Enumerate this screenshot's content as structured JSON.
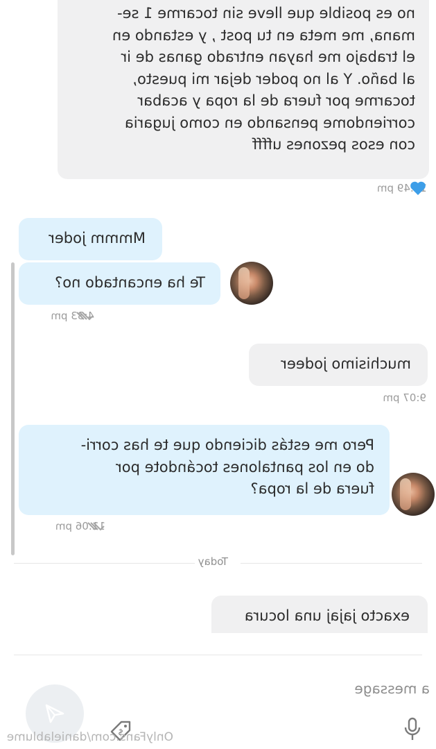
{
  "conversation": {
    "messages": [
      {
        "id": "m1",
        "direction": "outgoing",
        "lines": [
          "no es posible que lleve sin tocarme 1 se-",
          "mana, me meta en tu post , y estando en",
          "el trabajo me hayan entrado ganas de ir",
          "al baño. Y al no poder dejar mi puesto,",
          "tocarme por fuera de la ropa y acabar",
          "corriendome pensando en como jugaria",
          "con esos pezones uffff"
        ],
        "time": "12:49 pm",
        "liked": true
      },
      {
        "id": "m2",
        "direction": "incoming",
        "lines": [
          "Mmmm joder"
        ]
      },
      {
        "id": "m3",
        "direction": "incoming",
        "lines": [
          "Te ha encantado no?"
        ],
        "time": "4:33 pm"
      },
      {
        "id": "m4",
        "direction": "outgoing",
        "lines": [
          "muchisimo jodeer"
        ],
        "time": "9:07 pm"
      },
      {
        "id": "m5",
        "direction": "incoming",
        "lines": [
          "Pero me estás diciendo que te has corri-",
          "do en los pantalones tocándote por",
          "fuera de la ropa?"
        ],
        "time": "11:06 pm"
      },
      {
        "id": "m6",
        "direction": "outgoing",
        "lines": [
          "exacto jajaj una locura"
        ]
      }
    ],
    "day_separator": "Today"
  },
  "composer": {
    "placeholder": "a message"
  },
  "watermark": "OnlyFans.com/danielablume",
  "icons": {
    "like": "heart-icon",
    "read": "double-check-icon",
    "mic": "microphone-icon",
    "tip": "dollar-tag-icon",
    "send": "paper-plane-icon"
  },
  "colors": {
    "outgoing_bubble": "#f0f0f1",
    "incoming_bubble": "#dff2fd",
    "heart": "#3d9ee8",
    "meta_text": "#9b9b9b"
  }
}
